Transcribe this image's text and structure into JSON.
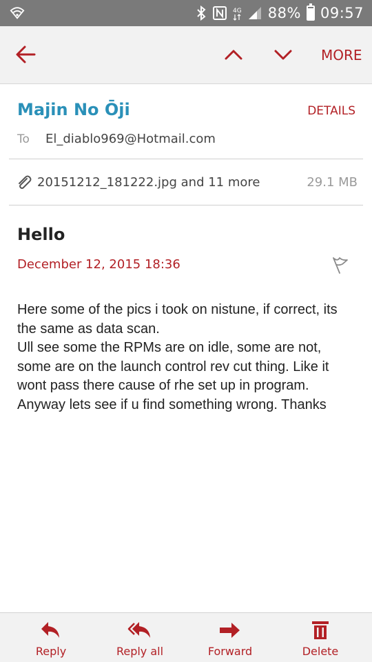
{
  "status_bar": {
    "battery": "88%",
    "time": "09:57",
    "icons": [
      "wifi-icon",
      "bluetooth-icon",
      "nfc-icon",
      "data-4g-icon",
      "signal-icon",
      "battery-icon"
    ]
  },
  "toolbar": {
    "back_icon": "back-arrow-icon",
    "prev_icon": "chevron-up-icon",
    "next_icon": "chevron-down-icon",
    "more_label": "MORE"
  },
  "header": {
    "sender": "Majin No Ōji",
    "details_label": "DETAILS",
    "to_label": "To",
    "to_address": "El_diablo969@Hotmail.com"
  },
  "attachment": {
    "icon": "paperclip-icon",
    "name": "20151212_181222.jpg and 11 more",
    "size": "29.1 MB"
  },
  "message": {
    "subject": "Hello",
    "date": "December 12, 2015  18:36",
    "flag_icon": "flag-icon",
    "lines": [
      "Here some of the pics i took on nistune, if correct,  its the same as data scan.",
      "Ull see some the RPMs are on idle, some are not, some are on the launch control rev cut thing. Like it wont pass there cause of rhe set up in program.",
      "Anyway lets see if u find something wrong. Thanks"
    ]
  },
  "bottom_bar": {
    "actions": [
      {
        "label": "Reply",
        "icon": "reply-icon"
      },
      {
        "label": "Reply all",
        "icon": "reply-all-icon"
      },
      {
        "label": "Forward",
        "icon": "forward-icon"
      },
      {
        "label": "Delete",
        "icon": "trash-icon"
      }
    ]
  },
  "colors": {
    "accent": "#b22025",
    "sender": "#2a90b8",
    "status_bar": "#7a7a7a",
    "toolbar": "#f2f2f2"
  }
}
